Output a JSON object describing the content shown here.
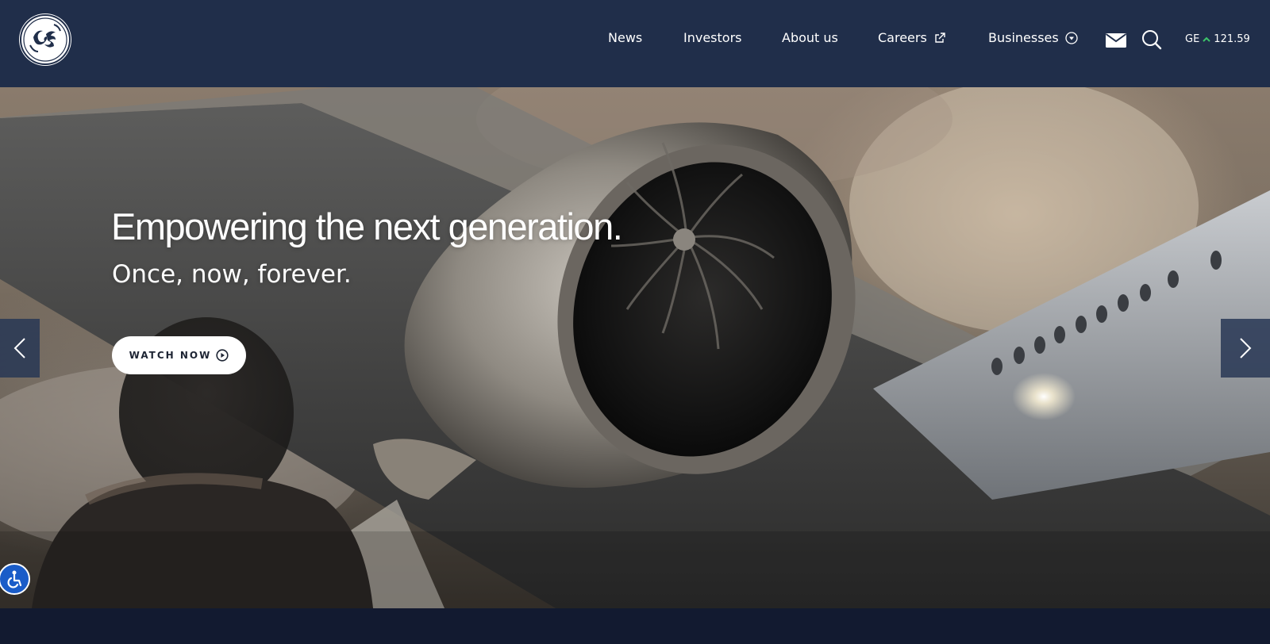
{
  "header": {
    "logo_alt": "GE",
    "nav": [
      {
        "label": "News"
      },
      {
        "label": "Investors"
      },
      {
        "label": "About us"
      },
      {
        "label": "Careers",
        "icon": "external-link-icon"
      },
      {
        "label": "Businesses",
        "icon": "chevron-down-circle-icon"
      }
    ],
    "icons": [
      "mail-icon",
      "search-icon"
    ],
    "stock": {
      "ticker": "GE",
      "trend": "up",
      "price": "121.59",
      "up_color": "#3cc46a"
    }
  },
  "hero": {
    "headline": "Empowering the next generation.",
    "subhead": "Once, now, forever.",
    "cta_label": "WATCH NOW",
    "cta_icon": "play-circle-icon",
    "prev_icon": "chevron-left-icon",
    "next_icon": "chevron-right-icon"
  },
  "accessibility": {
    "icon": "accessibility-icon",
    "color": "#1a5cc8"
  },
  "colors": {
    "header_bg": "#202e4a",
    "footer_bg": "#121a30"
  }
}
